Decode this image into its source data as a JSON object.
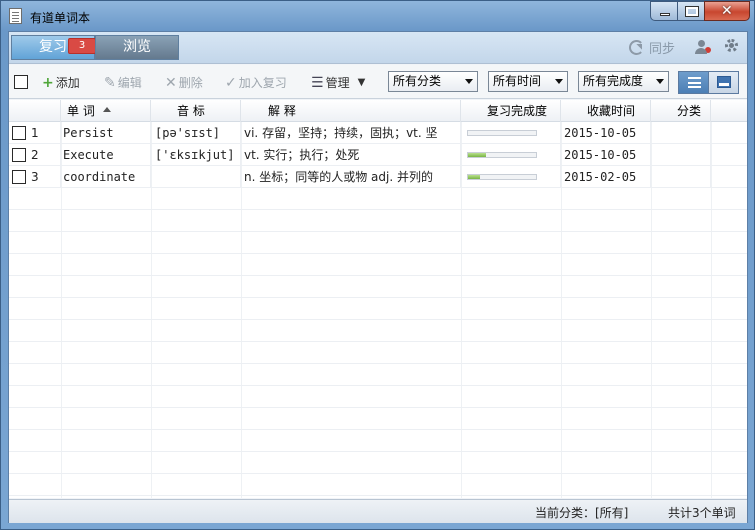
{
  "window": {
    "title": "有道单词本"
  },
  "tabs": {
    "review_label": "复习",
    "review_badge": "3",
    "browse_label": "浏览"
  },
  "topbar": {
    "sync_label": "同步"
  },
  "toolbar": {
    "add_label": "添加",
    "edit_label": "编辑",
    "delete_label": "删除",
    "add_review_label": "加入复习",
    "manage_label": "管理",
    "category_select": "所有分类",
    "time_select": "所有时间",
    "completion_select": "所有完成度"
  },
  "table": {
    "headers": {
      "word": "单 词",
      "phonetic": "音 标",
      "definition": "解 释",
      "progress": "复习完成度",
      "time": "收藏时间",
      "category": "分类"
    },
    "rows": [
      {
        "index": "1",
        "word": "Persist",
        "phonetic": "[pə'sɪst]",
        "definition": "vi. 存留，坚持；持续，固执；vt. 坚",
        "progress": 0,
        "time": "2015-10-05",
        "category": ""
      },
      {
        "index": "2",
        "word": "Execute",
        "phonetic": "['ɛksɪkjut]",
        "definition": "vt. 实行；执行；处死",
        "progress": 0.27,
        "time": "2015-10-05",
        "category": ""
      },
      {
        "index": "3",
        "word": "coordinate",
        "phonetic": "",
        "definition": "n. 坐标；同等的人或物 adj. 并列的",
        "progress": 0.17,
        "time": "2015-02-05",
        "category": ""
      }
    ]
  },
  "status": {
    "current_category": "当前分类：[所有]",
    "total": "共计3个单词"
  }
}
